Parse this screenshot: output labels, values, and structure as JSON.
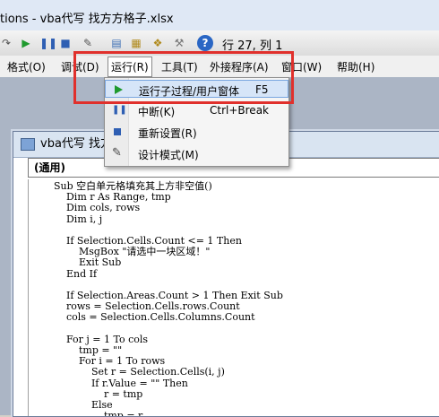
{
  "window": {
    "title": "tions - vba代写  找方方格子.xlsx"
  },
  "toolbar": {
    "position_text": "行 27, 列 1"
  },
  "menubar": {
    "items": [
      {
        "label": "格式(O)"
      },
      {
        "label": "调试(D)"
      },
      {
        "label": "运行(R)"
      },
      {
        "label": "工具(T)"
      },
      {
        "label": "外接程序(A)"
      },
      {
        "label": "窗口(W)"
      },
      {
        "label": "帮助(H)"
      }
    ]
  },
  "run_menu": {
    "items": [
      {
        "label": "运行子过程/用户窗体",
        "shortcut": "F5"
      },
      {
        "label": "中断(K)",
        "shortcut": "Ctrl+Break"
      },
      {
        "label": "重新设置(R)",
        "shortcut": ""
      },
      {
        "label": "设计模式(M)",
        "shortcut": ""
      }
    ]
  },
  "code_window": {
    "title": "vba代写  找方",
    "object_combo": "(通用)",
    "code": "Sub 空白单元格填充其上方非空值()\n    Dim r As Range, tmp\n    Dim cols, rows\n    Dim i, j\n\n    If Selection.Cells.Count <= 1 Then\n        MsgBox \"请选中一块区域！\"\n        Exit Sub\n    End If\n\n    If Selection.Areas.Count > 1 Then Exit Sub\n    rows = Selection.Cells.rows.Count\n    cols = Selection.Cells.Columns.Count\n\n    For j = 1 To cols\n        tmp = \"\"\n        For i = 1 To rows\n            Set r = Selection.Cells(i, j)\n            If r.Value = \"\" Then\n                r = tmp\n            Else\n                tmp = r"
  },
  "colors": {
    "highlight_box": "#e0302c",
    "run_icon": "#1f9a2e"
  }
}
